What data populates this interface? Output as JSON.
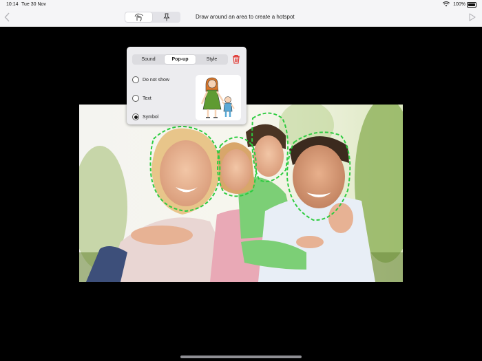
{
  "status": {
    "time": "10:14",
    "date": "Tue 30 Nov",
    "battery": "100%"
  },
  "toolbar": {
    "hint": "Draw around an area to create a hotspot"
  },
  "icons": {
    "back": "chevron-left-icon",
    "play": "play-icon",
    "draw": "draw-hand-icon",
    "pin": "pin-icon",
    "trash": "trash-icon"
  },
  "popover": {
    "tabs": [
      {
        "label": "Sound"
      },
      {
        "label": "Pop-up"
      },
      {
        "label": "Style"
      }
    ],
    "options": [
      {
        "label": "Do not show"
      },
      {
        "label": "Text"
      },
      {
        "label": "Symbol"
      }
    ]
  },
  "colors": {
    "hotspot": "#2ecc40",
    "trash": "#e0302a",
    "accent": "#000000"
  }
}
